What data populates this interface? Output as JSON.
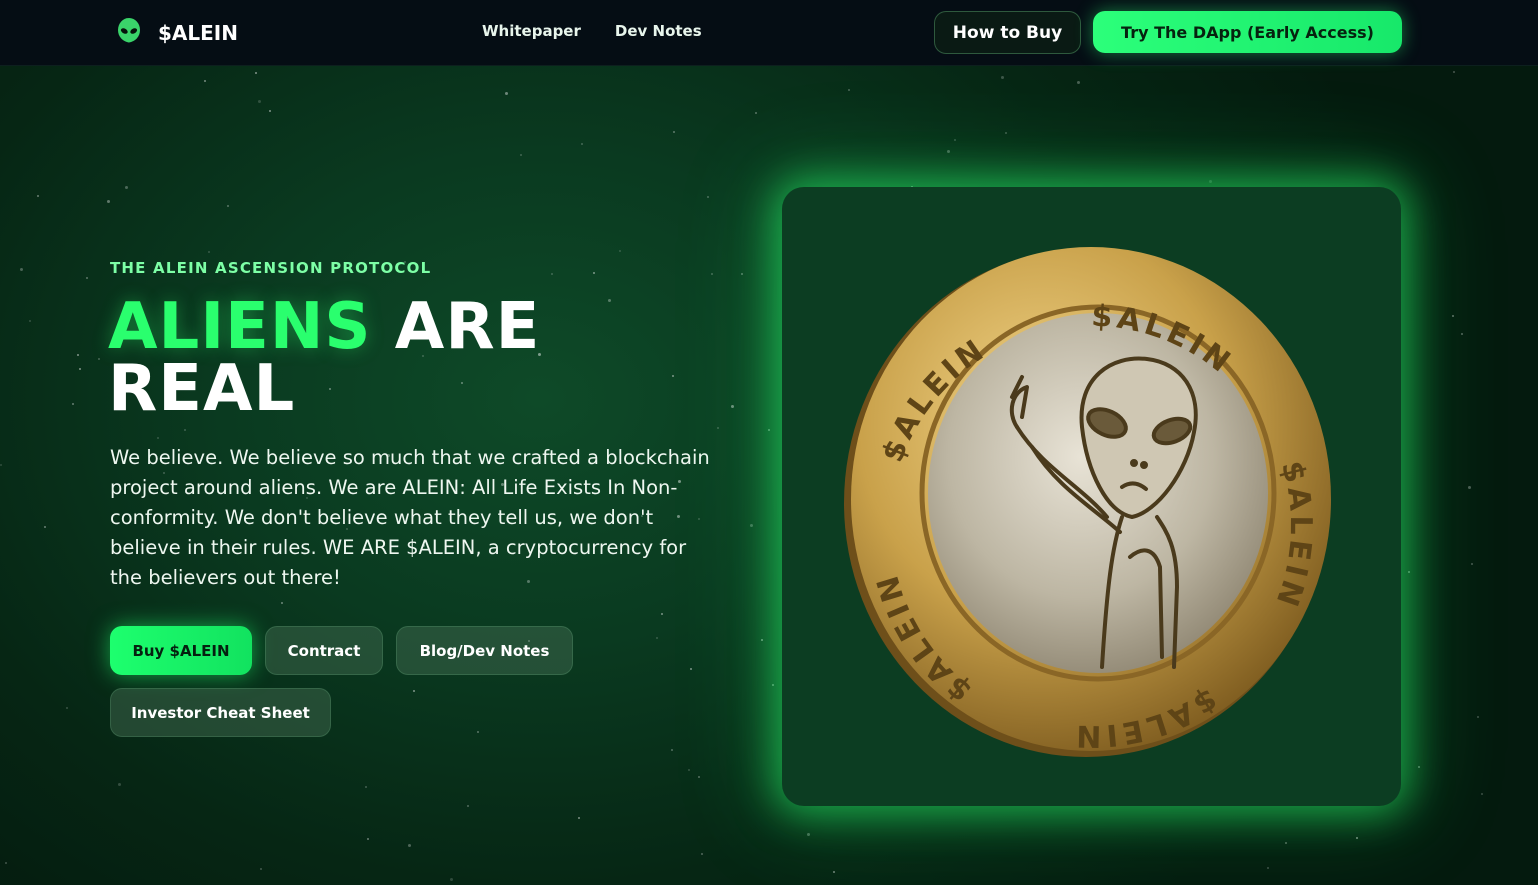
{
  "nav": {
    "brand": "$ALEIN",
    "links": [
      "Whitepaper",
      "Dev Notes"
    ],
    "how_to_buy": "How to Buy",
    "dapp": "Try The DApp (Early Access)"
  },
  "hero": {
    "eyebrow": "THE ALEIN ASCENSION PROTOCOL",
    "headline_highlight": "ALIENS",
    "headline_rest": " ARE REAL",
    "body": "We believe. We believe so much that we crafted a blockchain project around aliens. We are ALEIN: All Life Exists In Non-conformity. We don't believe what they tell us, we don't believe in their rules. WE ARE $ALEIN, a cryptocurrency for the believers out there!",
    "buttons": {
      "buy": "Buy $ALEIN",
      "contract": "Contract",
      "blog": "Blog/Dev Notes",
      "cheat_sheet": "Investor Cheat Sheet"
    }
  },
  "coin": {
    "ring_text": "$ALEIN"
  },
  "colors": {
    "accent": "#2aff6e",
    "nav_bg": "#050d14",
    "card_bg": "#0c3d22",
    "gold": "#c9a44a"
  }
}
